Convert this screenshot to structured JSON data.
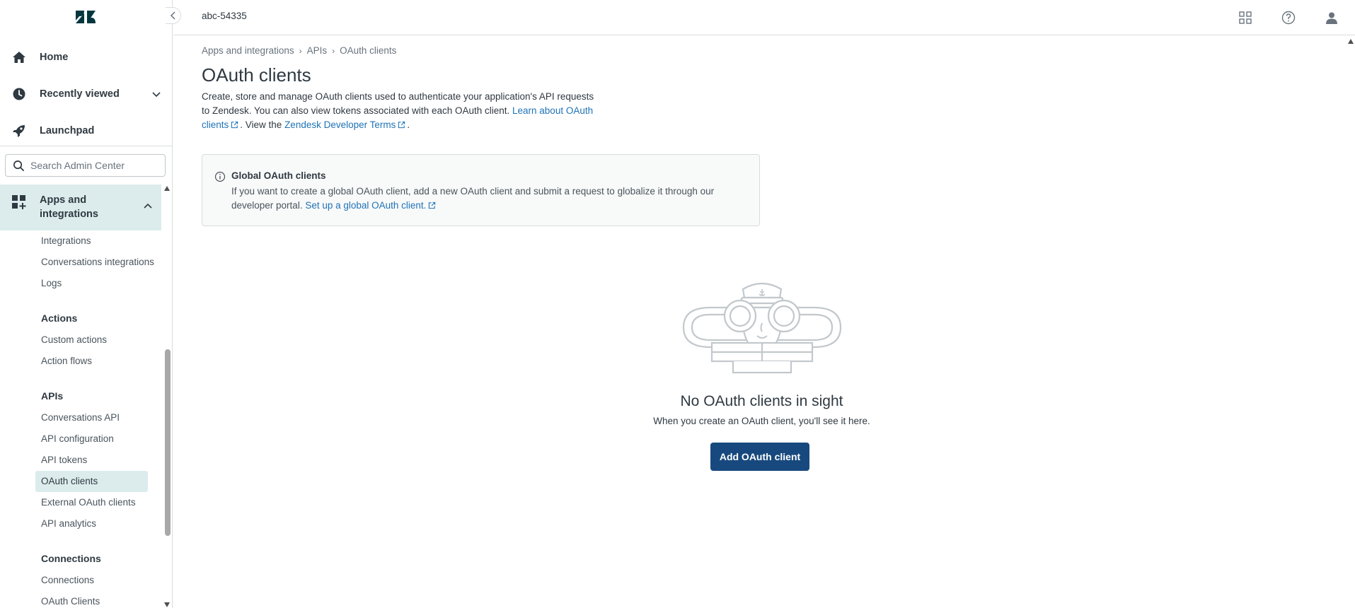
{
  "app": {
    "account": "abc-54335"
  },
  "nav": {
    "home": "Home",
    "recently_viewed": "Recently viewed",
    "launchpad": "Launchpad",
    "search_placeholder": "Search Admin Center",
    "section": "Apps and integrations",
    "items": [
      {
        "type": "item",
        "label": "Integrations"
      },
      {
        "type": "item",
        "label": "Conversations integrations"
      },
      {
        "type": "item",
        "label": "Logs"
      },
      {
        "type": "group",
        "label": "Actions"
      },
      {
        "type": "item",
        "label": "Custom actions"
      },
      {
        "type": "item",
        "label": "Action flows"
      },
      {
        "type": "group",
        "label": "APIs"
      },
      {
        "type": "item",
        "label": "Conversations API"
      },
      {
        "type": "item",
        "label": "API configuration"
      },
      {
        "type": "item",
        "label": "API tokens"
      },
      {
        "type": "item",
        "label": "OAuth clients",
        "active": true
      },
      {
        "type": "item",
        "label": "External OAuth clients"
      },
      {
        "type": "item",
        "label": "API analytics"
      },
      {
        "type": "group",
        "label": "Connections"
      },
      {
        "type": "item",
        "label": "Connections"
      },
      {
        "type": "item",
        "label": "OAuth Clients"
      }
    ]
  },
  "breadcrumb": [
    "Apps and integrations",
    "APIs",
    "OAuth clients"
  ],
  "page": {
    "title": "OAuth clients",
    "desc_text1": "Create, store and manage OAuth clients used to authenticate your application's API requests to Zendesk. You can also view tokens associated with each OAuth client. ",
    "desc_link1": "Learn about OAuth clients",
    "desc_text2": ". View the ",
    "desc_link2": "Zendesk Developer Terms",
    "desc_text3": "."
  },
  "notice": {
    "title": "Global OAuth clients",
    "body": "If you want to create a global OAuth client, add a new OAuth client and submit a request to globalize it through our developer portal. ",
    "link": "Set up a global OAuth client."
  },
  "empty": {
    "title": "No OAuth clients in sight",
    "subtitle": "When you create an OAuth client, you'll see it here.",
    "button": "Add OAuth client"
  },
  "icons": {
    "logo": "zendesk-logo",
    "products": "grid-icon",
    "help": "help-icon",
    "profile": "user-icon"
  },
  "colors": {
    "brand": "#17497e",
    "link": "#1f73b7",
    "active_nav": "#dcecec"
  }
}
